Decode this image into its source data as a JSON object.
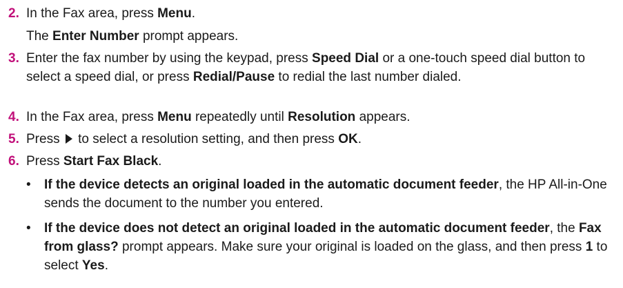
{
  "steps": [
    {
      "number": "2.",
      "line1": {
        "t1": "In the Fax area, press ",
        "b1": "Menu",
        "t2": "."
      },
      "line2": {
        "t1": "The ",
        "b1": "Enter Number",
        "t2": " prompt appears."
      }
    },
    {
      "number": "3.",
      "t1": "Enter the fax number by using the keypad, press ",
      "b1": "Speed Dial",
      "t2": " or a one-touch speed dial button to select a speed dial, or press ",
      "b2": "Redial/Pause",
      "t3": " to redial the last number dialed."
    },
    {
      "number": "4.",
      "t1": "In the Fax area, press ",
      "b1": "Menu",
      "t2": " repeatedly until ",
      "b2": "Resolution",
      "t3": " appears."
    },
    {
      "number": "5.",
      "t1": "Press ",
      "icon": "right-arrow-icon",
      "t2": " to select a resolution setting, and then press ",
      "b1": "OK",
      "t3": "."
    },
    {
      "number": "6.",
      "t1": "Press ",
      "b1": "Start Fax Black",
      "t2": "."
    }
  ],
  "bullets": [
    {
      "b1": "If the device detects an original loaded in the automatic document feeder",
      "t1": ", the HP All-in-One sends the document to the number you entered."
    },
    {
      "b1": "If the device does not detect an original loaded in the automatic document feeder",
      "t1": ", the ",
      "b2": "Fax from glass?",
      "t2": " prompt appears. Make sure your original is loaded on the glass, and then press ",
      "b3": "1",
      "t3": " to select ",
      "b4": "Yes",
      "t4": "."
    }
  ],
  "bullet_glyph": "•"
}
